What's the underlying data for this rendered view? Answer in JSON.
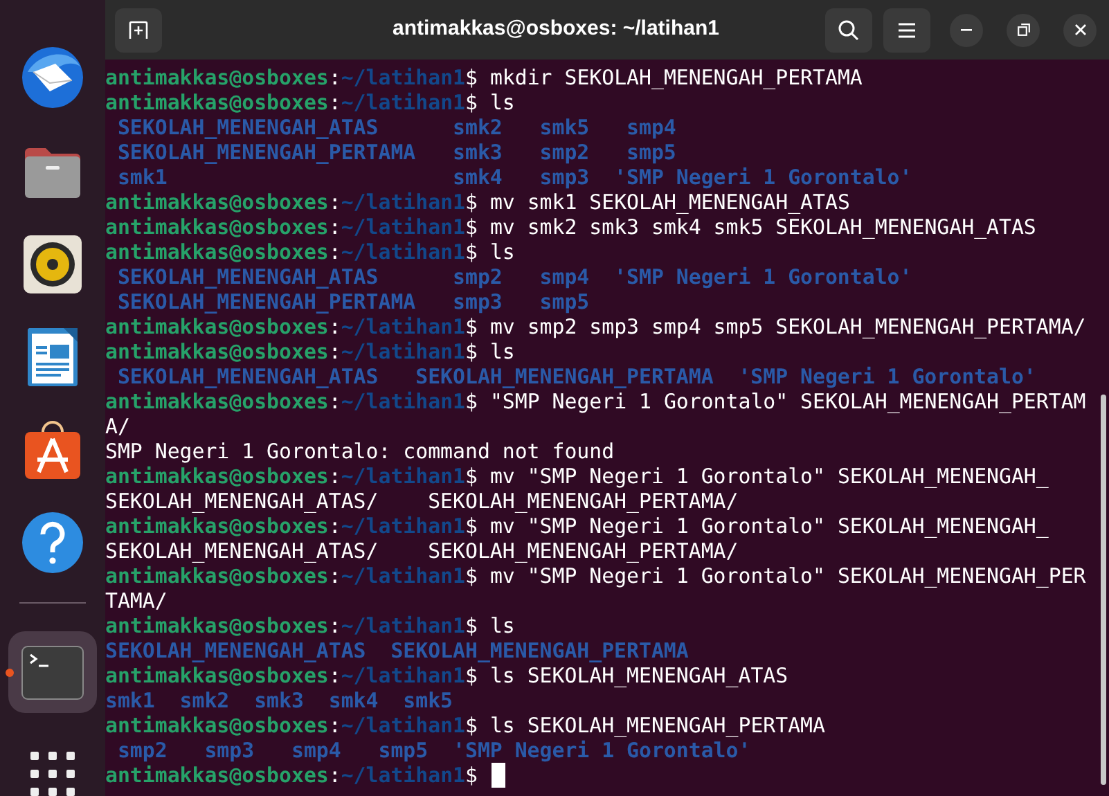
{
  "window": {
    "title": "antimakkas@osboxes: ~/latihan1"
  },
  "dock": {
    "items": [
      {
        "kind": "mail",
        "running": false
      },
      {
        "kind": "files",
        "running": false
      },
      {
        "kind": "speaker",
        "running": false
      },
      {
        "kind": "writer",
        "running": false
      },
      {
        "kind": "store",
        "running": false
      },
      {
        "kind": "help",
        "running": false
      },
      {
        "kind": "terminal",
        "running": true
      }
    ]
  },
  "terminal": {
    "lines": [
      {
        "kind": "prompt",
        "user_host": "antimakkas@osboxes",
        "separator": ":",
        "path": "~/latihan1",
        "symbol": "$",
        "command": "mkdir SEKOLAH_MENENGAH_PERTAMA"
      },
      {
        "kind": "prompt",
        "user_host": "antimakkas@osboxes",
        "separator": ":",
        "path": "~/latihan1",
        "symbol": "$",
        "command": "ls"
      },
      {
        "kind": "listing",
        "text": " SEKOLAH_MENENGAH_ATAS      smk2   smk5   smp4"
      },
      {
        "kind": "listing",
        "text": " SEKOLAH_MENENGAH_PERTAMA   smk3   smp2   smp5"
      },
      {
        "kind": "listing",
        "text": " smk1                       smk4   smp3  'SMP Negeri 1 Gorontalo'"
      },
      {
        "kind": "prompt",
        "user_host": "antimakkas@osboxes",
        "separator": ":",
        "path": "~/latihan1",
        "symbol": "$",
        "command": "mv smk1 SEKOLAH_MENENGAH_ATAS"
      },
      {
        "kind": "prompt",
        "user_host": "antimakkas@osboxes",
        "separator": ":",
        "path": "~/latihan1",
        "symbol": "$",
        "command": "mv smk2 smk3 smk4 smk5 SEKOLAH_MENENGAH_ATAS"
      },
      {
        "kind": "prompt",
        "user_host": "antimakkas@osboxes",
        "separator": ":",
        "path": "~/latihan1",
        "symbol": "$",
        "command": "ls"
      },
      {
        "kind": "listing",
        "text": " SEKOLAH_MENENGAH_ATAS      smp2   smp4  'SMP Negeri 1 Gorontalo'"
      },
      {
        "kind": "listing",
        "text": " SEKOLAH_MENENGAH_PERTAMA   smp3   smp5"
      },
      {
        "kind": "prompt",
        "user_host": "antimakkas@osboxes",
        "separator": ":",
        "path": "~/latihan1",
        "symbol": "$",
        "command": "mv smp2 smp3 smp4 smp5 SEKOLAH_MENENGAH_PERTAMA/"
      },
      {
        "kind": "prompt",
        "user_host": "antimakkas@osboxes",
        "separator": ":",
        "path": "~/latihan1",
        "symbol": "$",
        "command": "ls"
      },
      {
        "kind": "listing",
        "text": " SEKOLAH_MENENGAH_ATAS   SEKOLAH_MENENGAH_PERTAMA  'SMP Negeri 1 Gorontalo'"
      },
      {
        "kind": "prompt",
        "user_host": "antimakkas@osboxes",
        "separator": ":",
        "path": "~/latihan1",
        "symbol": "$",
        "command": "\"SMP Negeri 1 Gorontalo\" SEKOLAH_MENENGAH_PERTAM"
      },
      {
        "kind": "plain",
        "text": "A/"
      },
      {
        "kind": "plain",
        "text": "SMP Negeri 1 Gorontalo: command not found"
      },
      {
        "kind": "prompt",
        "user_host": "antimakkas@osboxes",
        "separator": ":",
        "path": "~/latihan1",
        "symbol": "$",
        "command": "mv \"SMP Negeri 1 Gorontalo\" SEKOLAH_MENENGAH_"
      },
      {
        "kind": "plain",
        "text": "SEKOLAH_MENENGAH_ATAS/    SEKOLAH_MENENGAH_PERTAMA/"
      },
      {
        "kind": "prompt",
        "user_host": "antimakkas@osboxes",
        "separator": ":",
        "path": "~/latihan1",
        "symbol": "$",
        "command": "mv \"SMP Negeri 1 Gorontalo\" SEKOLAH_MENENGAH_"
      },
      {
        "kind": "plain",
        "text": "SEKOLAH_MENENGAH_ATAS/    SEKOLAH_MENENGAH_PERTAMA/"
      },
      {
        "kind": "prompt",
        "user_host": "antimakkas@osboxes",
        "separator": ":",
        "path": "~/latihan1",
        "symbol": "$",
        "command": "mv \"SMP Negeri 1 Gorontalo\" SEKOLAH_MENENGAH_PER"
      },
      {
        "kind": "plain",
        "text": "TAMA/"
      },
      {
        "kind": "prompt",
        "user_host": "antimakkas@osboxes",
        "separator": ":",
        "path": "~/latihan1",
        "symbol": "$",
        "command": "ls"
      },
      {
        "kind": "listing",
        "text": "SEKOLAH_MENENGAH_ATAS  SEKOLAH_MENENGAH_PERTAMA"
      },
      {
        "kind": "prompt",
        "user_host": "antimakkas@osboxes",
        "separator": ":",
        "path": "~/latihan1",
        "symbol": "$",
        "command": "ls SEKOLAH_MENENGAH_ATAS"
      },
      {
        "kind": "listing",
        "text": "smk1  smk2  smk3  smk4  smk5"
      },
      {
        "kind": "prompt",
        "user_host": "antimakkas@osboxes",
        "separator": ":",
        "path": "~/latihan1",
        "symbol": "$",
        "command": "ls SEKOLAH_MENENGAH_PERTAMA"
      },
      {
        "kind": "listing",
        "text": " smp2   smp3   smp4   smp5  'SMP Negeri 1 Gorontalo'"
      },
      {
        "kind": "cursor_prompt",
        "user_host": "antimakkas@osboxes",
        "separator": ":",
        "path": "~/latihan1",
        "symbol": "$"
      }
    ]
  }
}
